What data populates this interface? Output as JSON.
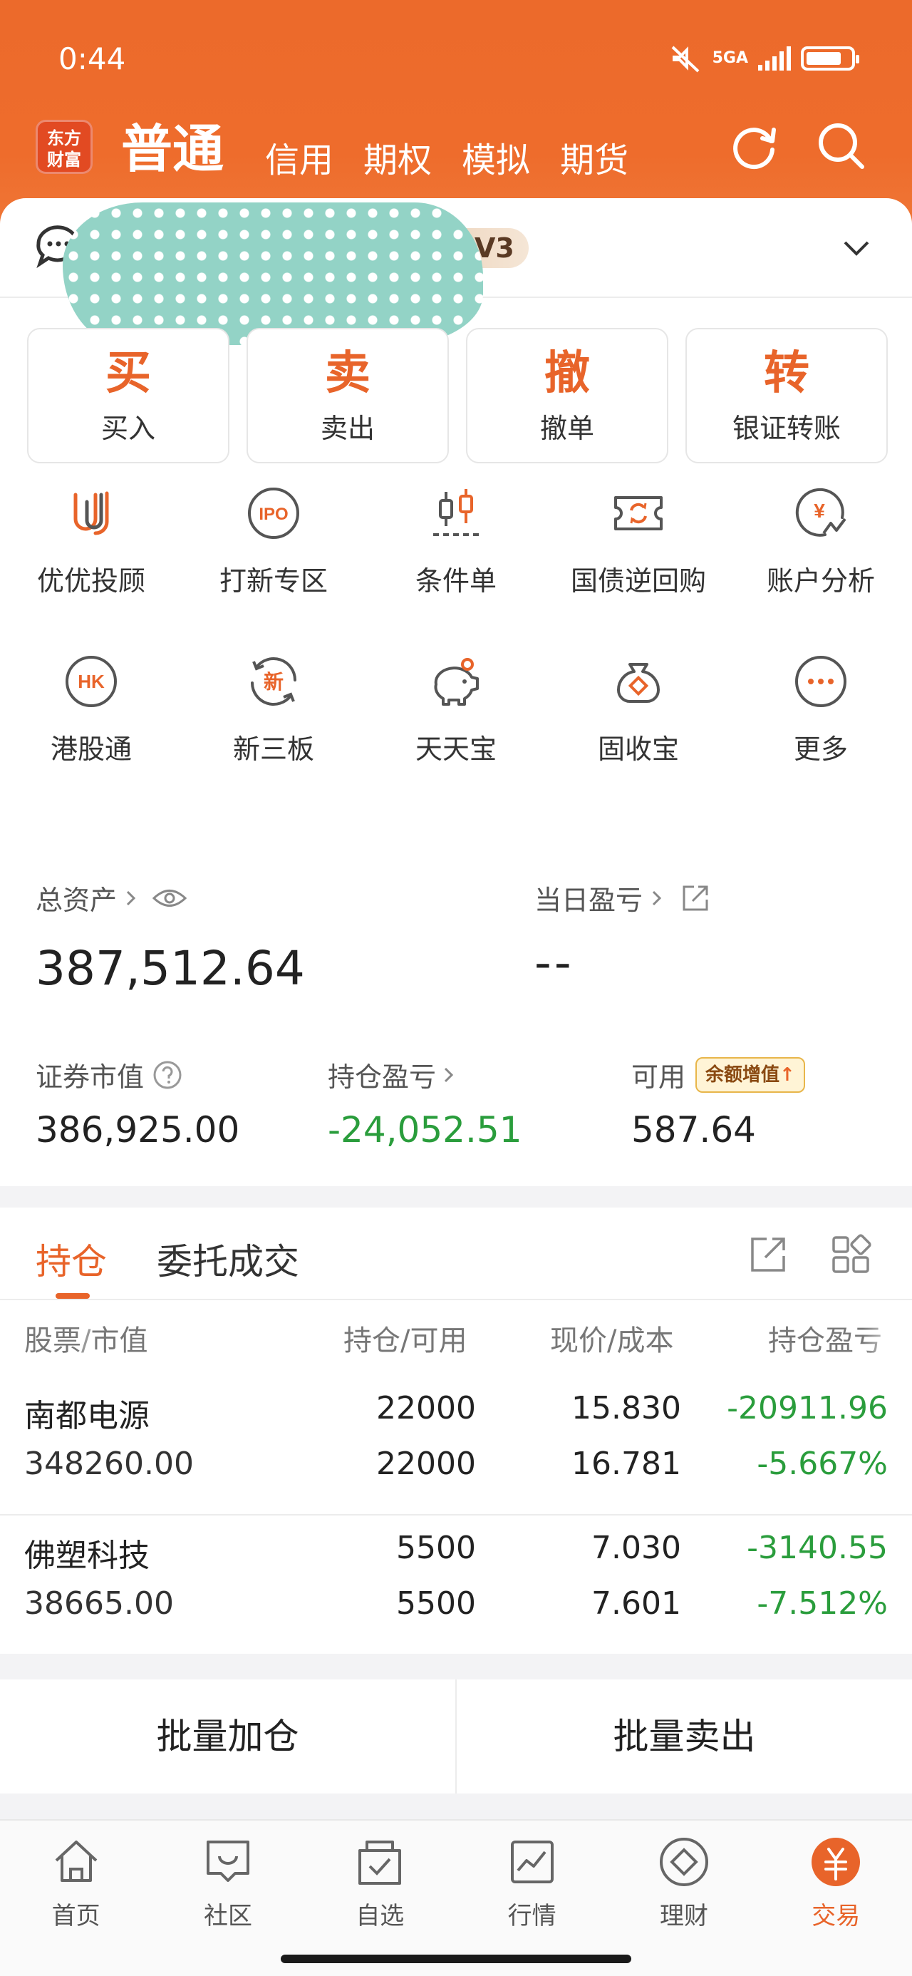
{
  "status_bar": {
    "time": "0:44",
    "network": "5GA",
    "battery_level": 0.8
  },
  "header": {
    "logo_line1": "东方",
    "logo_line2": "财富",
    "tabs": [
      {
        "label": "普通",
        "active": true
      },
      {
        "label": "信用"
      },
      {
        "label": "期权"
      },
      {
        "label": "模拟"
      },
      {
        "label": "期货"
      }
    ]
  },
  "account": {
    "level_badge": "V3"
  },
  "trade_buttons": [
    {
      "big": "买",
      "small": "买入"
    },
    {
      "big": "卖",
      "small": "卖出"
    },
    {
      "big": "撤",
      "small": "撤单"
    },
    {
      "big": "转",
      "small": "银证转账"
    }
  ],
  "feature_grid": [
    {
      "label": "优优投顾",
      "icon": "uu-advisor-icon"
    },
    {
      "label": "打新专区",
      "icon": "ipo-icon",
      "icon_text": "IPO"
    },
    {
      "label": "条件单",
      "icon": "candlestick-icon"
    },
    {
      "label": "国债逆回购",
      "icon": "reverse-repo-icon"
    },
    {
      "label": "账户分析",
      "icon": "account-analysis-icon",
      "icon_text": "¥"
    },
    {
      "label": "港股通",
      "icon": "hk-icon",
      "icon_text": "HK"
    },
    {
      "label": "新三板",
      "icon": "new-board-icon",
      "icon_text": "新"
    },
    {
      "label": "天天宝",
      "icon": "piggy-bank-icon"
    },
    {
      "label": "固收宝",
      "icon": "money-bag-icon"
    },
    {
      "label": "更多",
      "icon": "more-icon"
    }
  ],
  "assets": {
    "total_label": "总资产",
    "total_value": "387,512.64",
    "daily_label": "当日盈亏",
    "daily_value": "--",
    "securities_label": "证券市值",
    "securities_value": "386,925.00",
    "position_pnl_label": "持仓盈亏",
    "position_pnl_value": "-24,052.51",
    "available_label": "可用",
    "available_value": "587.64",
    "promo_badge": "余额增值"
  },
  "holdings": {
    "tabs": [
      "持仓",
      "委托成交"
    ],
    "columns": {
      "stock": "股票",
      "stock_sep": "/",
      "market_value": "市值",
      "position": "持仓/可用",
      "price": "现价/成本",
      "pnl": "持仓盈亏"
    },
    "rows": [
      {
        "name": "南都电源",
        "market_value": "348260.00",
        "position": "22000",
        "available": "22000",
        "price": "15.830",
        "cost": "16.781",
        "pnl": "-20911.96",
        "pnl_pct": "-5.667%"
      },
      {
        "name": "佛塑科技",
        "market_value": "38665.00",
        "position": "5500",
        "available": "5500",
        "price": "7.030",
        "cost": "7.601",
        "pnl": "-3140.55",
        "pnl_pct": "-7.512%"
      }
    ]
  },
  "batch": {
    "add": "批量加仓",
    "sell": "批量卖出"
  },
  "bottom_nav": [
    {
      "label": "首页",
      "icon": "home-icon"
    },
    {
      "label": "社区",
      "icon": "community-icon"
    },
    {
      "label": "自选",
      "icon": "watchlist-icon"
    },
    {
      "label": "行情",
      "icon": "market-icon"
    },
    {
      "label": "理财",
      "icon": "wealth-icon"
    },
    {
      "label": "交易",
      "icon": "trade-icon",
      "active": true
    }
  ],
  "colors": {
    "brand": "#ee6c2c",
    "accent": "#e8642a",
    "loss_green": "#2a9d3c"
  }
}
